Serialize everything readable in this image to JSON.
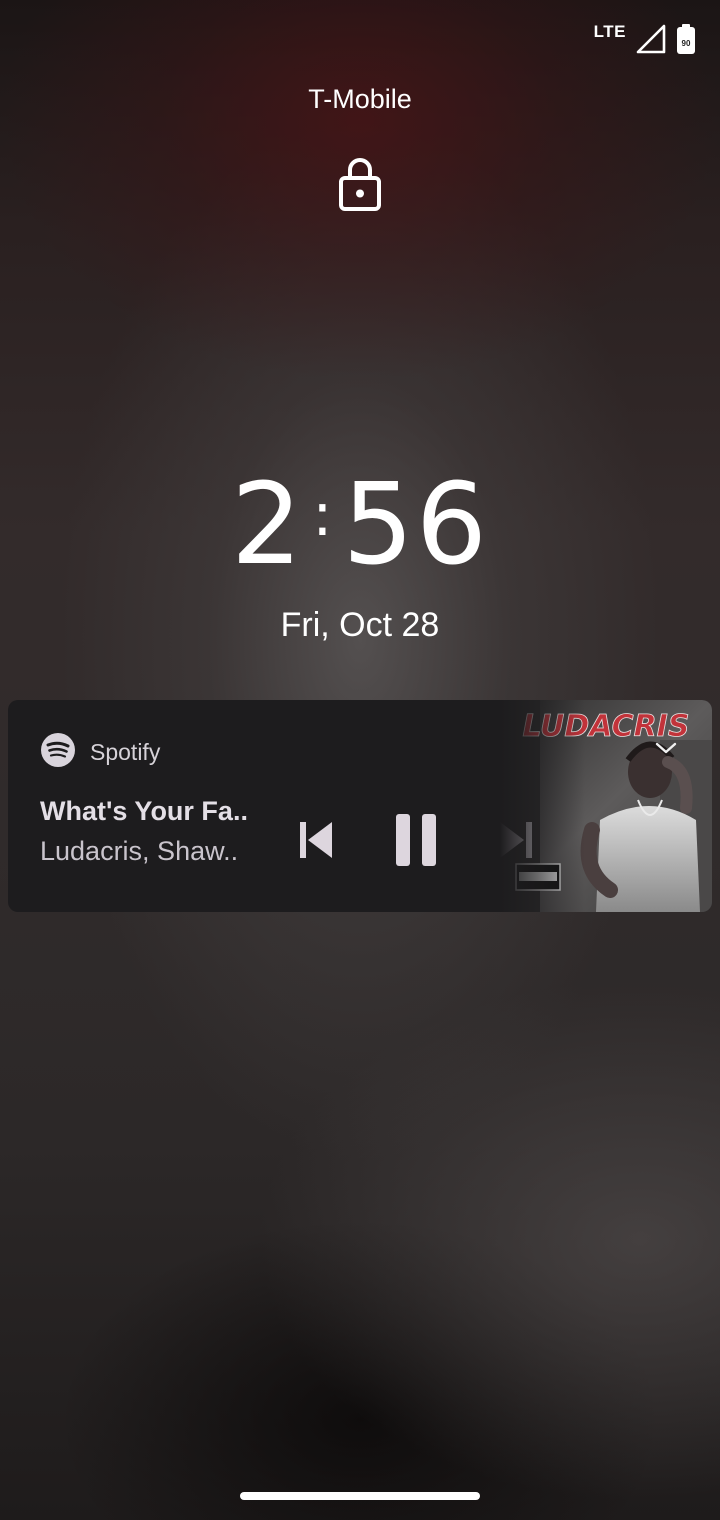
{
  "status_bar": {
    "network": "LTE",
    "signal_icon": "cell-signal-icon",
    "battery_icon": "battery-icon",
    "battery_level": "90"
  },
  "lockscreen": {
    "carrier": "T-Mobile",
    "lock_icon": "lock-icon",
    "time_hour": "2",
    "time_minutes": "56",
    "date": "Fri, Oct 28"
  },
  "media": {
    "app_name": "Spotify",
    "app_icon": "spotify-icon",
    "track_title": "What's Your Fa..",
    "track_artist": "Ludacris, Shaw..",
    "album_banner": "LUDACRIS",
    "controls": [
      "previous-track-icon",
      "pause-icon",
      "next-track-icon"
    ],
    "colors": {
      "card_bg": "#1d1c1e",
      "control": "#ddd6de",
      "album_red": "#c2333a"
    }
  },
  "home_indicator": "home-bar"
}
